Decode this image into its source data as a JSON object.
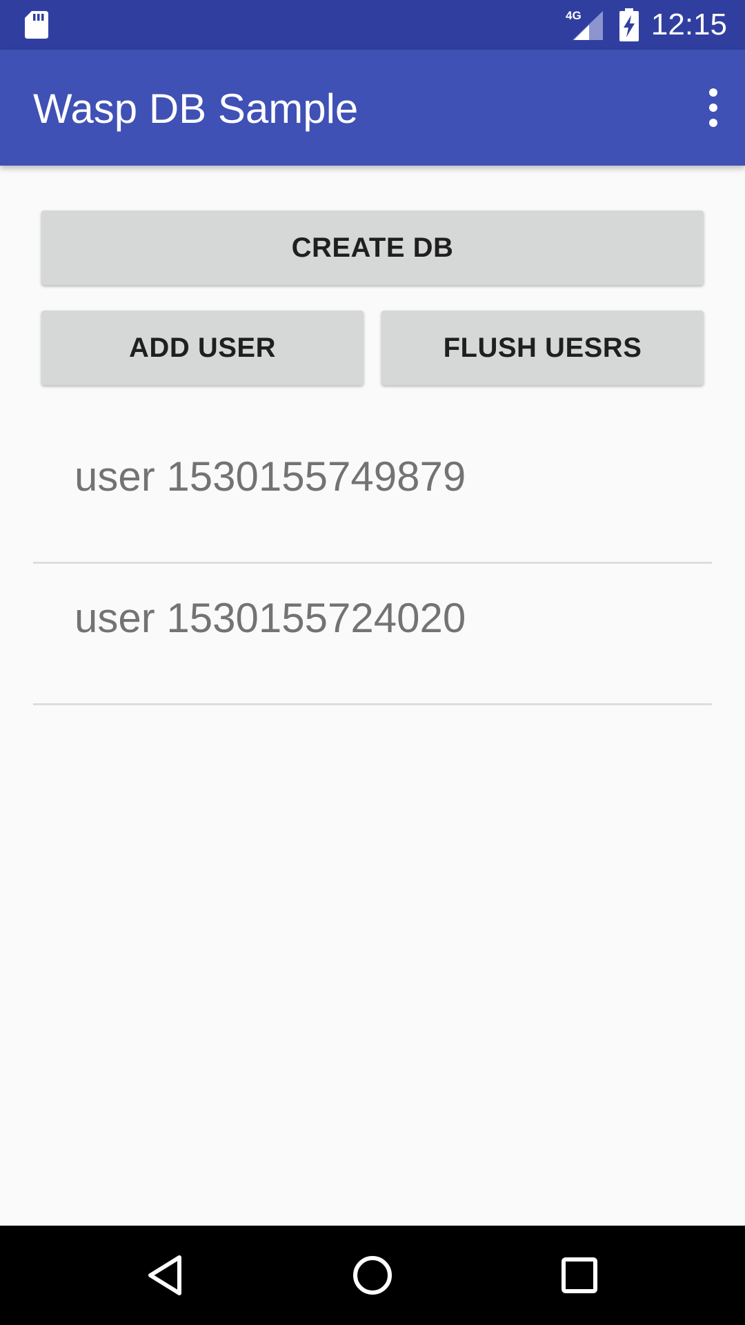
{
  "status_bar": {
    "time": "12:15",
    "network_label": "4G",
    "icons": [
      "sd-card-icon",
      "signal-icon",
      "battery-charging-icon"
    ]
  },
  "app_bar": {
    "title": "Wasp DB Sample",
    "overflow_icon": "more-vert-icon"
  },
  "buttons": {
    "create_db": "CREATE DB",
    "add_user": "ADD USER",
    "flush_users": "FLUSH UESRS"
  },
  "users": [
    {
      "label": "user 1530155749879"
    },
    {
      "label": "user 1530155724020"
    }
  ],
  "nav_bar": {
    "icons": [
      "back-icon",
      "home-icon",
      "recents-icon"
    ]
  },
  "colors": {
    "primary": "#3f51b5",
    "primary_dark": "#303f9f",
    "background": "#fafafa",
    "button": "#d6d7d7",
    "list_text": "#737373"
  }
}
